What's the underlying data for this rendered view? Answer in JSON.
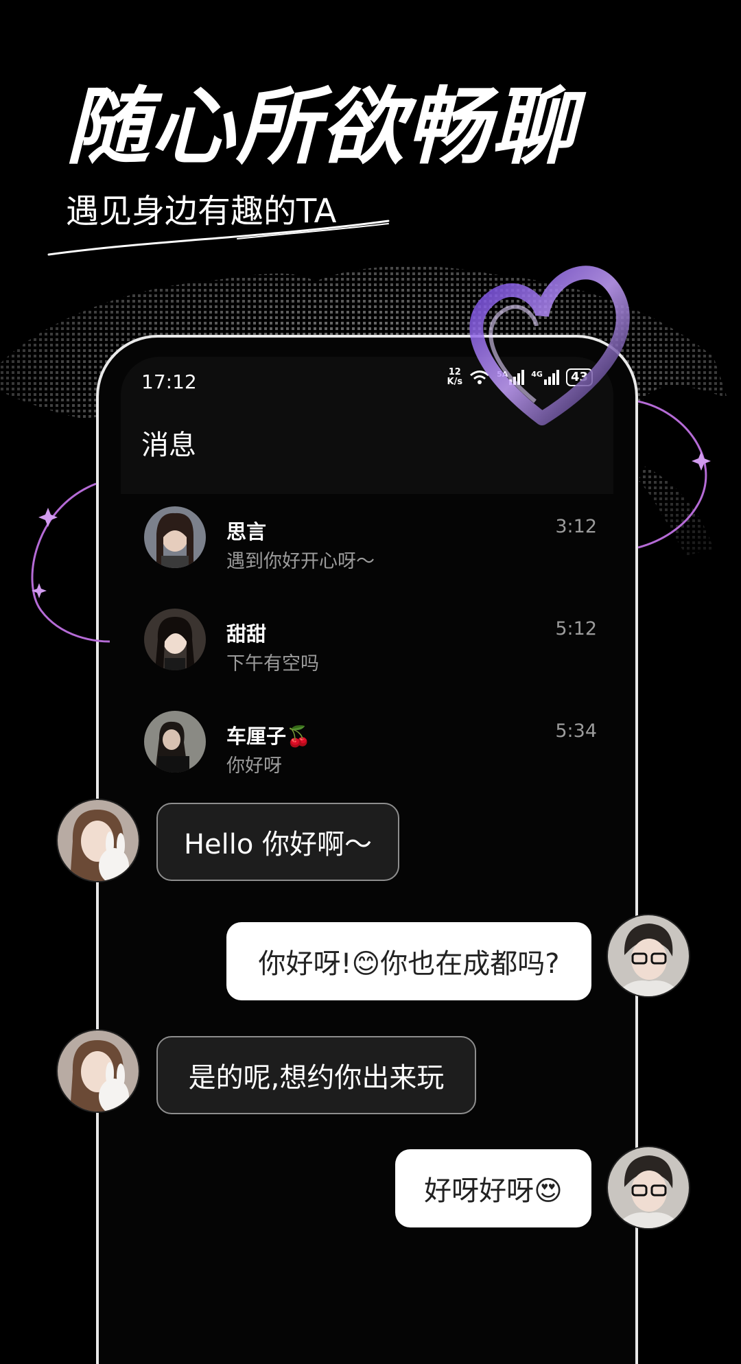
{
  "hero": {
    "title": "随心所欲畅聊",
    "subtitle": "遇见身边有趣的TA"
  },
  "status_bar": {
    "time": "17:12",
    "net_speed_value": "12",
    "net_speed_unit": "K/s",
    "signal_1_label": "5A",
    "signal_2_label": "4G",
    "battery": "43"
  },
  "header": {
    "title": "消息"
  },
  "conversations": [
    {
      "name": "思言",
      "preview": "遇到你好开心呀～",
      "time": "3:12"
    },
    {
      "name": "甜甜",
      "preview": "下午有空吗",
      "time": "5:12"
    },
    {
      "name": "车厘子🍒",
      "preview": "你好呀",
      "time": "5:34"
    }
  ],
  "chat": [
    {
      "side": "left",
      "text": "Hello 你好啊～"
    },
    {
      "side": "right",
      "text": "你好呀!😊你也在成都吗?"
    },
    {
      "side": "left",
      "text": "是的呢,想约你出来玩"
    },
    {
      "side": "right",
      "text": "好呀好呀😍"
    }
  ],
  "colors": {
    "background": "#000000",
    "accent_purple": "#a45cff",
    "bubble_dark": "#1d1d1d",
    "bubble_light": "#ffffff",
    "muted_text": "#9c9c9c"
  }
}
